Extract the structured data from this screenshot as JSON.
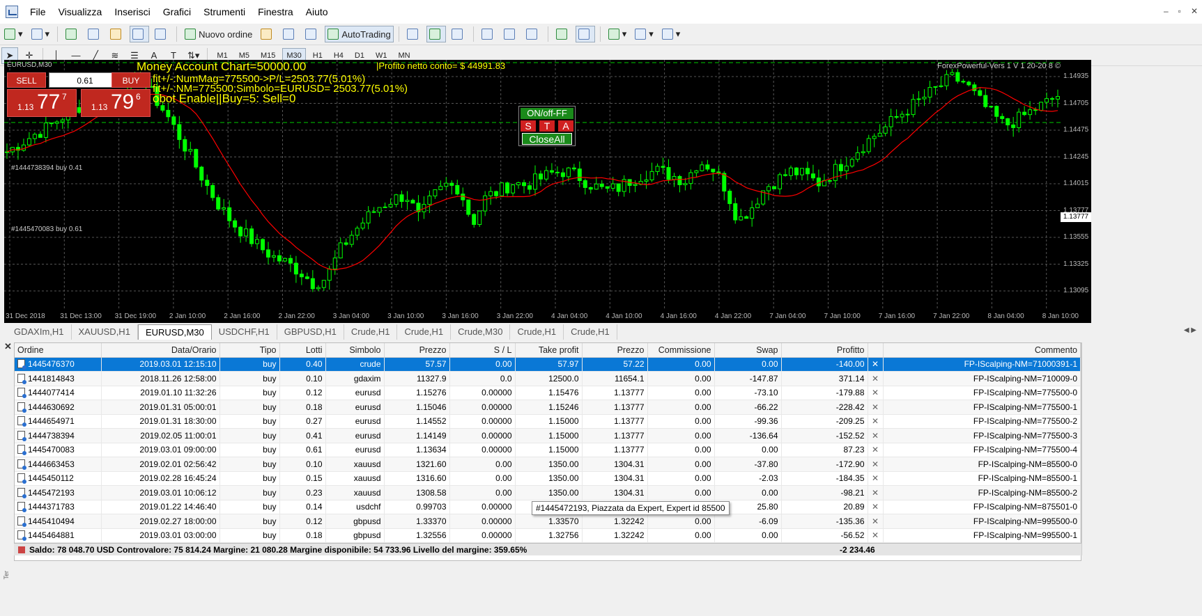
{
  "menu": [
    "File",
    "Visualizza",
    "Inserisci",
    "Grafici",
    "Strumenti",
    "Finestra",
    "Aiuto"
  ],
  "window_controls": [
    "–",
    "▫",
    "✕"
  ],
  "toolbar": {
    "new_order_label": "Nuovo ordine",
    "autotrading_label": "AutoTrading"
  },
  "timeframes": [
    "M1",
    "M5",
    "M15",
    "M30",
    "H1",
    "H4",
    "D1",
    "W1",
    "MN"
  ],
  "active_timeframe": "M30",
  "chart": {
    "symbol_label": "EURUSD,M30",
    "overlay_lines": [
      "Money Account Chart=50000.00",
      "|Profito netto conto= $ 44991.83",
      "fit+/-:NumMag=775500->P/L=2503.77(5.01%)",
      "fit+/-:NM=775500;Simbolo=EURUSD= 2503.77(5.01%)",
      "obot Enable||Buy=5: Sell=0"
    ],
    "indicator_name": "ForexPowerful-Vers 1 V 1 20-20 8 ©",
    "trade_panel": {
      "sell": "SELL",
      "buy": "BUY",
      "lot": "0.61",
      "sell_small": "1.13",
      "sell_big": "77",
      "sell_pip": "7",
      "buy_small": "1.13",
      "buy_big": "79",
      "buy_pip": "6"
    },
    "controls": {
      "onoff": "ON/off-FF",
      "s": "S",
      "t": "T",
      "a": "A",
      "close_all": "CloseAll"
    },
    "order_labels": [
      "#1444738394 buy 0.41",
      "#1445470083 buy 0.61"
    ],
    "current_price": "1.13777",
    "colors": {
      "bull": "#00ff00",
      "bear": "#00ff00",
      "ma": "#ff0000",
      "grid": "#555555",
      "overlay": "#ffff00"
    }
  },
  "chart_data": {
    "type": "candlestick",
    "symbol": "EURUSD",
    "timeframe": "M30",
    "y_ticks": [
      "1.14935",
      "1.14705",
      "1.14475",
      "1.14245",
      "1.14015",
      "1.13777",
      "1.13555",
      "1.13325",
      "1.13095"
    ],
    "x_ticks": [
      "31 Dec 2018",
      "31 Dec 13:00",
      "31 Dec 19:00",
      "2 Jan 10:00",
      "2 Jan 16:00",
      "2 Jan 22:00",
      "3 Jan 04:00",
      "3 Jan 10:00",
      "3 Jan 16:00",
      "3 Jan 22:00",
      "4 Jan 04:00",
      "4 Jan 10:00",
      "4 Jan 16:00",
      "4 Jan 22:00",
      "7 Jan 04:00",
      "7 Jan 10:00",
      "7 Jan 16:00",
      "7 Jan 22:00",
      "8 Jan 04:00",
      "8 Jan 10:00"
    ],
    "ylim": [
      1.1295,
      1.1505
    ],
    "close": [
      1.1428,
      1.1435,
      1.1442,
      1.1448,
      1.1456,
      1.1463,
      1.147,
      1.1475,
      1.1467,
      1.148,
      1.149,
      1.1475,
      1.1459,
      1.144,
      1.142,
      1.14,
      1.1382,
      1.1368,
      1.1358,
      1.1348,
      1.134,
      1.1335,
      1.1328,
      1.1318,
      1.1322,
      1.1345,
      1.136,
      1.1372,
      1.1382,
      1.1388,
      1.1392,
      1.1372,
      1.139,
      1.14,
      1.1398,
      1.1368,
      1.139,
      1.1395,
      1.1402,
      1.14,
      1.1405,
      1.141,
      1.1412,
      1.1407,
      1.14,
      1.1395,
      1.1398,
      1.1405,
      1.141,
      1.1412,
      1.1408,
      1.1404,
      1.142,
      1.1415,
      1.1398,
      1.137,
      1.1382,
      1.1398,
      1.1405,
      1.1412,
      1.1408,
      1.1402,
      1.141,
      1.142,
      1.143,
      1.144,
      1.1448,
      1.1458,
      1.1466,
      1.1474,
      1.1482,
      1.149,
      1.1486,
      1.1472,
      1.146,
      1.145,
      1.1455,
      1.1462,
      1.1468,
      1.1475
    ]
  },
  "tabs": [
    "GDAXIm,H1",
    "XAUUSD,H1",
    "EURUSD,M30",
    "USDCHF,H1",
    "GBPUSD,H1",
    "Crude,H1",
    "Crude,H1",
    "Crude,M30",
    "Crude,H1",
    "Crude,H1"
  ],
  "active_tab": 2,
  "columns": [
    "Ordine",
    "Data/Orario",
    "Tipo",
    "Lotti",
    "Simbolo",
    "Prezzo",
    "S / L",
    "Take profit",
    "Prezzo",
    "Commissione",
    "Swap",
    "Profitto",
    "",
    "Commento"
  ],
  "orders": [
    [
      "1445476370",
      "2019.03.01 12:15:10",
      "buy",
      "0.40",
      "crude",
      "57.57",
      "0.00",
      "57.97",
      "57.22",
      "0.00",
      "0.00",
      "-140.00",
      "✕",
      "FP-IScalping-NM=71000391-1"
    ],
    [
      "1441814843",
      "2018.11.26 12:58:00",
      "buy",
      "0.10",
      "gdaxim",
      "11327.9",
      "0.0",
      "12500.0",
      "11654.1",
      "0.00",
      "-147.87",
      "371.14",
      "✕",
      "FP-IScalping-NM=710009-0"
    ],
    [
      "1444077414",
      "2019.01.10 11:32:26",
      "buy",
      "0.12",
      "eurusd",
      "1.15276",
      "0.00000",
      "1.15476",
      "1.13777",
      "0.00",
      "-73.10",
      "-179.88",
      "✕",
      "FP-IScalping-NM=775500-0"
    ],
    [
      "1444630692",
      "2019.01.31 05:00:01",
      "buy",
      "0.18",
      "eurusd",
      "1.15046",
      "0.00000",
      "1.15246",
      "1.13777",
      "0.00",
      "-66.22",
      "-228.42",
      "✕",
      "FP-IScalping-NM=775500-1"
    ],
    [
      "1444654971",
      "2019.01.31 18:30:00",
      "buy",
      "0.27",
      "eurusd",
      "1.14552",
      "0.00000",
      "1.15000",
      "1.13777",
      "0.00",
      "-99.36",
      "-209.25",
      "✕",
      "FP-IScalping-NM=775500-2"
    ],
    [
      "1444738394",
      "2019.02.05 11:00:01",
      "buy",
      "0.41",
      "eurusd",
      "1.14149",
      "0.00000",
      "1.15000",
      "1.13777",
      "0.00",
      "-136.64",
      "-152.52",
      "✕",
      "FP-IScalping-NM=775500-3"
    ],
    [
      "1445470083",
      "2019.03.01 09:00:00",
      "buy",
      "0.61",
      "eurusd",
      "1.13634",
      "0.00000",
      "1.15000",
      "1.13777",
      "0.00",
      "0.00",
      "87.23",
      "✕",
      "FP-IScalping-NM=775500-4"
    ],
    [
      "1444663453",
      "2019.02.01 02:56:42",
      "buy",
      "0.10",
      "xauusd",
      "1321.60",
      "0.00",
      "1350.00",
      "1304.31",
      "0.00",
      "-37.80",
      "-172.90",
      "✕",
      "FP-IScalping-NM=85500-0"
    ],
    [
      "1445450112",
      "2019.02.28 16:45:24",
      "buy",
      "0.15",
      "xauusd",
      "1316.60",
      "0.00",
      "1350.00",
      "1304.31",
      "0.00",
      "-2.03",
      "-184.35",
      "✕",
      "FP-IScalping-NM=85500-1"
    ],
    [
      "1445472193",
      "2019.03.01 10:06:12",
      "buy",
      "0.23",
      "xauusd",
      "1308.58",
      "0.00",
      "1350.00",
      "1304.31",
      "0.00",
      "0.00",
      "-98.21",
      "✕",
      "FP-IScalping-NM=85500-2"
    ],
    [
      "1444371783",
      "2019.01.22 14:46:40",
      "buy",
      "0.14",
      "usdchf",
      "0.99703",
      "0.00000",
      "",
      "",
      "",
      "25.80",
      "20.89",
      "✕",
      "FP-IScalping-NM=875501-0"
    ],
    [
      "1445410494",
      "2019.02.27 18:00:00",
      "buy",
      "0.12",
      "gbpusd",
      "1.33370",
      "0.00000",
      "1.33570",
      "1.32242",
      "0.00",
      "-6.09",
      "-135.36",
      "✕",
      "FP-IScalping-NM=995500-0"
    ],
    [
      "1445464881",
      "2019.03.01 03:00:00",
      "buy",
      "0.18",
      "gbpusd",
      "1.32556",
      "0.00000",
      "1.32756",
      "1.32242",
      "0.00",
      "0.00",
      "-56.52",
      "✕",
      "FP-IScalping-NM=995500-1"
    ]
  ],
  "tooltip": "#1445472193, Piazzata da Expert, Expert id 85500",
  "summary": {
    "text": "Saldo: 78 048.70 USD  Controvalore: 75 814.24  Margine: 21 080.28  Margine disponibile: 54 733.96  Livello del margine: 359.65%",
    "total": "-2 234.46"
  },
  "side_label": "Ter"
}
